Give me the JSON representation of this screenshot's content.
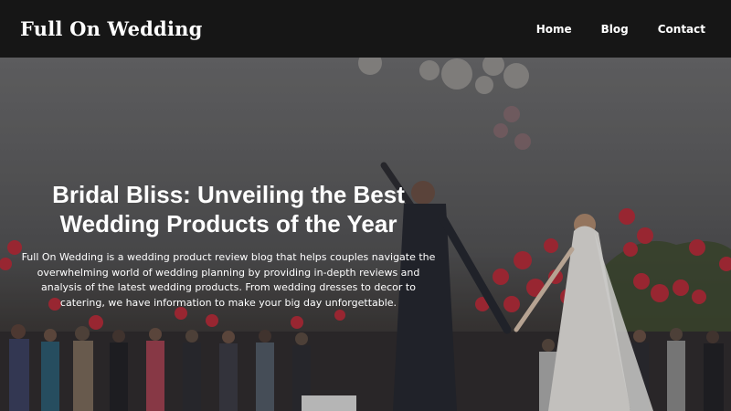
{
  "brand": "Full On Wedding",
  "nav": {
    "home": "Home",
    "blog": "Blog",
    "contact": "Contact"
  },
  "hero": {
    "title": "Bridal Bliss: Unveiling the Best Wedding Products of the Year",
    "description": "Full On Wedding is a wedding product review blog that helps couples navigate the overwhelming world of wedding planning by providing in-depth reviews and analysis of the latest wedding products. From wedding dresses to decor to catering, we have information to make your big day unforgettable.",
    "image": "wedding-couple-balloons"
  },
  "colors": {
    "navbar_bg": "#161616",
    "text": "#ffffff",
    "balloon_red": "#c8283a"
  }
}
